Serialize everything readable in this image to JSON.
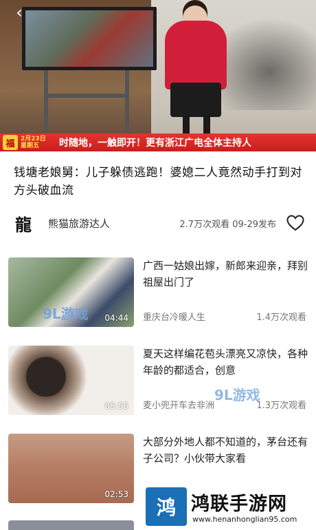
{
  "player": {
    "back_glyph": "‹",
    "ticker": {
      "badge": "福",
      "date_line1": "2月23日",
      "date_line2": "星期五",
      "text": "时随地，一触即开！更有浙江广电全体主持人"
    }
  },
  "video": {
    "title": "钱塘老娘舅：儿子躲债逃跑！婆媳二人竟然动手打到对方头破血流",
    "author_logo": "龍",
    "author_name": "熊猫旅游达人",
    "stats": "2.7万次观看 09-29发布",
    "like_icon": "heart-icon"
  },
  "related": [
    {
      "title": "广西一姑娘出嫁，新郎来迎亲，拜别祖屋出门了",
      "duration": "04:44",
      "source": "重庆台冷暖人生",
      "views": "1.4万次观看"
    },
    {
      "title": "夏天这样编花苞头漂亮又凉快，各种年龄的都适合，创意",
      "duration": "05:55",
      "source": "麦小兜开车去非洲",
      "views": "1.3万次观看"
    },
    {
      "title": "大部分外地人都不知道的，茅台还有子公司？小伙带大家看",
      "duration": "02:53",
      "source": "",
      "views": ""
    }
  ],
  "watermarks": {
    "thumb_mark": "9L游戏",
    "mid_mark": "9L游戏"
  },
  "brand": {
    "logo_text": "鸿",
    "name": "鸿联手游网",
    "url": "www.henanhonglian95.com"
  },
  "colors": {
    "ticker_red": "#d3221f",
    "brand_blue": "#1a6fb5"
  }
}
